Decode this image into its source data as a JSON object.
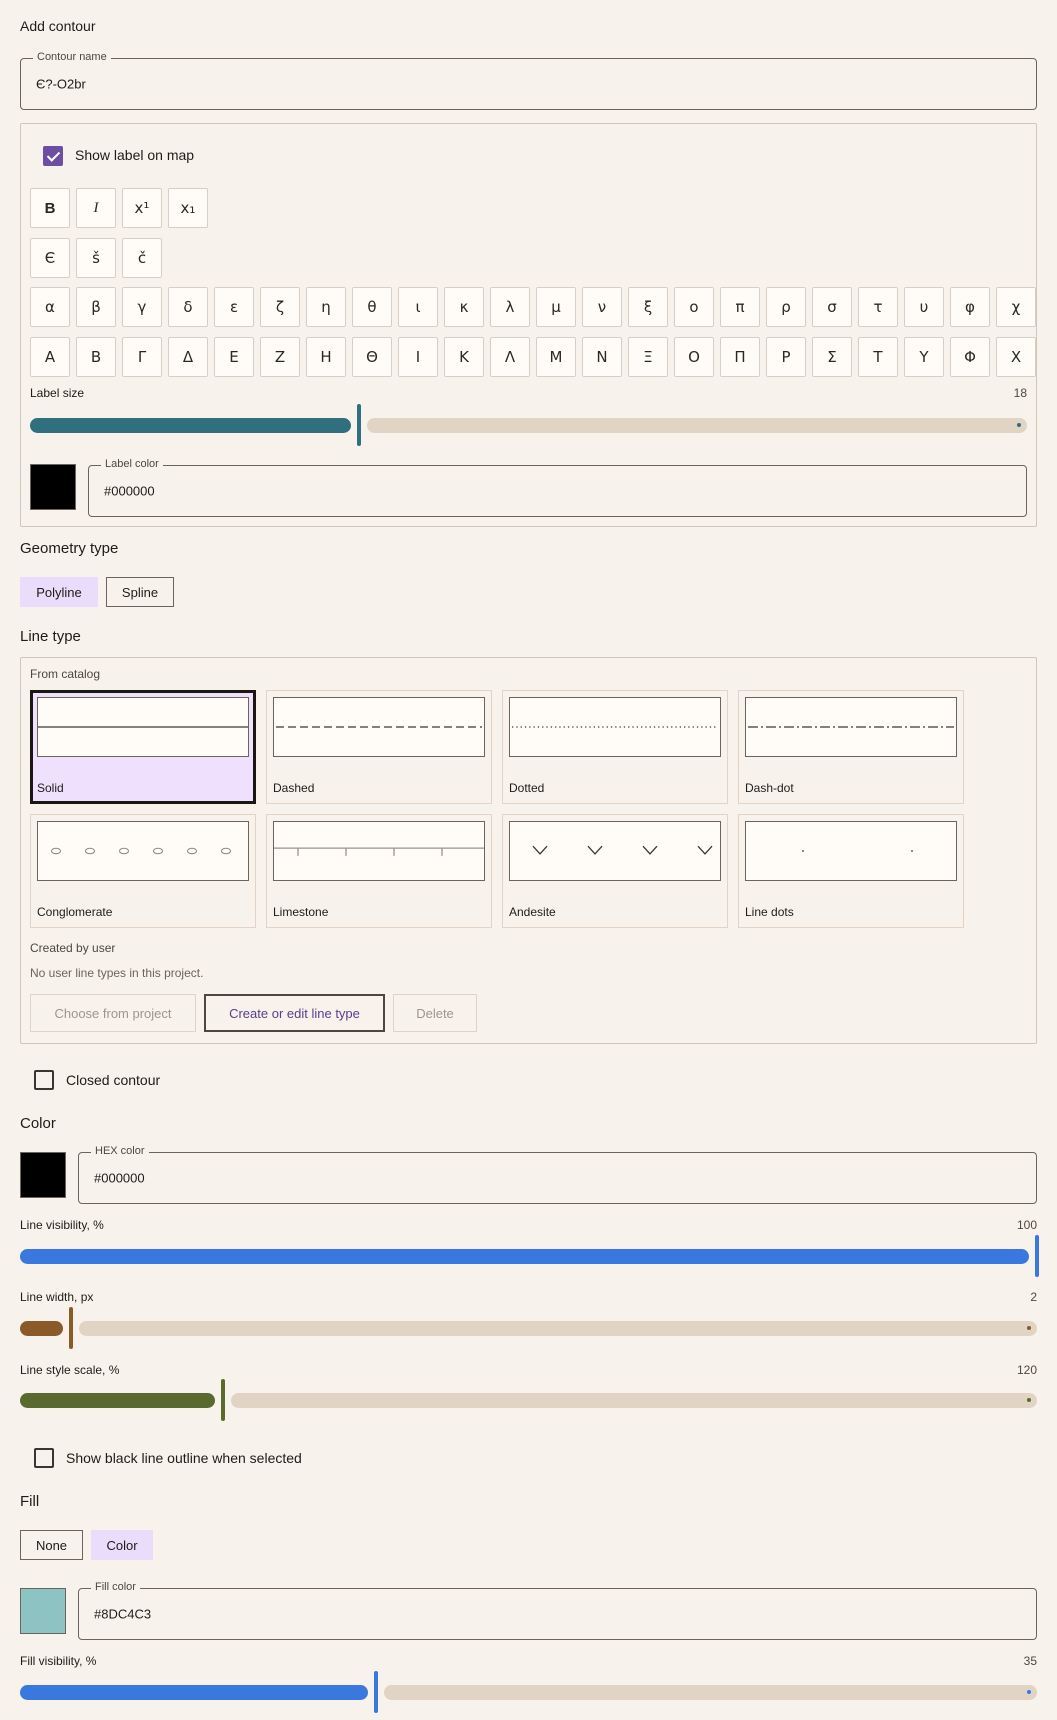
{
  "title": "Add contour",
  "contour_name": {
    "label": "Contour name",
    "value": "Є?-O2br"
  },
  "label_settings": {
    "show_label_checkbox": {
      "label": "Show label on map",
      "checked": true
    },
    "format_buttons": [
      "B",
      "I",
      "x¹",
      "x₁"
    ],
    "special_chars": [
      "Є",
      "š",
      "č"
    ],
    "greek_lower": [
      "α",
      "β",
      "γ",
      "δ",
      "ε",
      "ζ",
      "η",
      "θ",
      "ι",
      "κ",
      "λ",
      "μ",
      "ν",
      "ξ",
      "ο",
      "π",
      "ρ",
      "σ",
      "τ",
      "υ",
      "φ",
      "χ"
    ],
    "greek_upper": [
      "Α",
      "Β",
      "Γ",
      "Δ",
      "Ε",
      "Ζ",
      "Η",
      "Θ",
      "Ι",
      "Κ",
      "Λ",
      "Μ",
      "Ν",
      "Ξ",
      "Ο",
      "Π",
      "Ρ",
      "Σ",
      "Τ",
      "Υ",
      "Φ",
      "Χ"
    ],
    "label_size": {
      "label": "Label size",
      "value": "18",
      "fraction": 0.33,
      "color": "#2f6f7e"
    },
    "label_color": {
      "label": "Label color",
      "value": "#000000",
      "swatch": "#000000"
    }
  },
  "geometry": {
    "heading": "Geometry type",
    "options": [
      {
        "label": "Polyline",
        "selected": true
      },
      {
        "label": "Spline",
        "selected": false
      }
    ]
  },
  "line_type": {
    "heading": "Line type",
    "catalog_label": "From catalog",
    "cards": [
      {
        "name": "Solid",
        "selected": true,
        "pattern": "solid"
      },
      {
        "name": "Dashed",
        "selected": false,
        "pattern": "dashed"
      },
      {
        "name": "Dotted",
        "selected": false,
        "pattern": "dotted"
      },
      {
        "name": "Dash-dot",
        "selected": false,
        "pattern": "dashdot"
      },
      {
        "name": "Conglomerate",
        "selected": false,
        "pattern": "conglomerate"
      },
      {
        "name": "Limestone",
        "selected": false,
        "pattern": "limestone"
      },
      {
        "name": "Andesite",
        "selected": false,
        "pattern": "andesite"
      },
      {
        "name": "Line dots",
        "selected": false,
        "pattern": "linedots"
      }
    ],
    "user_label": "Created by user",
    "user_empty": "No user line types in this project.",
    "buttons": {
      "choose": "Choose from project",
      "create": "Create or edit line type",
      "delete": "Delete"
    }
  },
  "closed_contour": {
    "label": "Closed contour",
    "checked": false
  },
  "color": {
    "heading": "Color",
    "hex": {
      "label": "HEX color",
      "value": "#000000",
      "swatch": "#000000"
    },
    "line_visibility": {
      "label": "Line visibility, %",
      "value": "100",
      "fraction": 1.0,
      "color": "#3a78e0"
    },
    "line_width": {
      "label": "Line width, px",
      "value": "2",
      "fraction": 0.05,
      "color": "#8b5a2b"
    },
    "line_style_scale": {
      "label": "Line style scale, %",
      "value": "120",
      "fraction": 0.2,
      "color": "#5a6a2e"
    }
  },
  "outline_checkbox": {
    "label": "Show black line outline when selected",
    "checked": false
  },
  "fill": {
    "heading": "Fill",
    "options": [
      {
        "label": "None",
        "selected": false
      },
      {
        "label": "Color",
        "selected": true
      }
    ],
    "fill_color": {
      "label": "Fill color",
      "value": "#8DC4C3",
      "swatch": "#8DC4C3"
    },
    "fill_visibility": {
      "label": "Fill visibility, %",
      "value": "35",
      "fraction": 0.35,
      "color": "#3a78e0"
    }
  }
}
